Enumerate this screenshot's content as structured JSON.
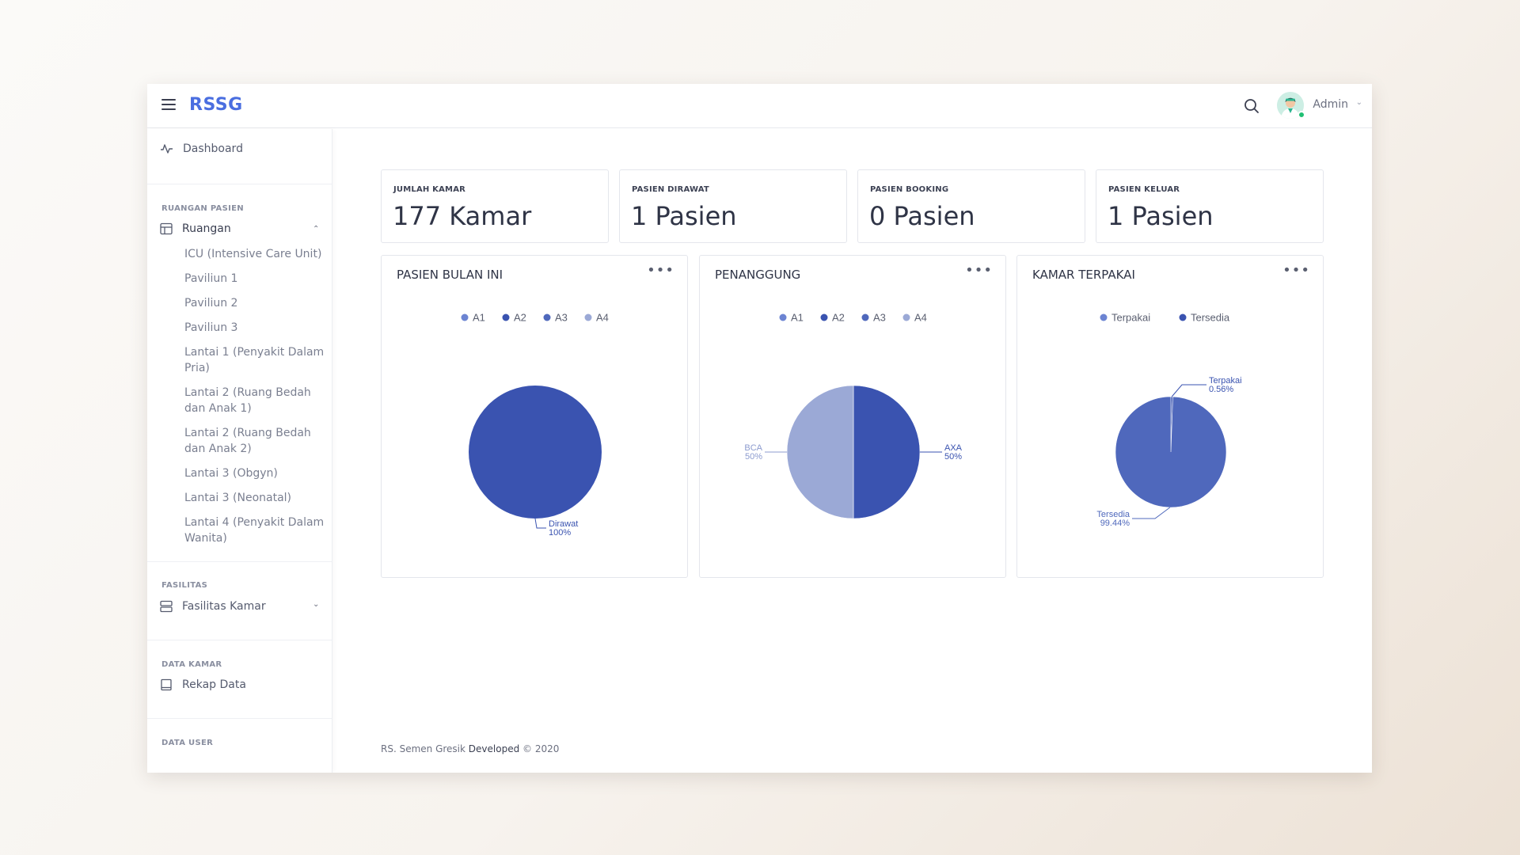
{
  "header": {
    "brand": "RSSG",
    "user_name": "Admin"
  },
  "sidebar": {
    "dashboard": "Dashboard",
    "sections": [
      {
        "heading": "RUANGAN PASIEN",
        "item": "Ruangan"
      },
      {
        "heading": "FASILITAS",
        "item": "Fasilitas Kamar"
      },
      {
        "heading": "DATA KAMAR",
        "item": "Rekap Data"
      },
      {
        "heading": "DATA USER"
      }
    ],
    "ruangan_items": [
      "ICU (Intensive Care Unit)",
      "Paviliun 1",
      "Paviliun 2",
      "Paviliun 3",
      "Lantai 1 (Penyakit Dalam Pria)",
      "Lantai 2 (Ruang Bedah dan Anak 1)",
      "Lantai 2 (Ruang Bedah dan Anak 2)",
      "Lantai 3 (Obgyn)",
      "Lantai 3 (Neonatal)",
      "Lantai 4 (Penyakit Dalam Wanita)"
    ]
  },
  "stats": [
    {
      "label": "JUMLAH KAMAR",
      "value": "177 Kamar"
    },
    {
      "label": "PASIEN DIRAWAT",
      "value": "1 Pasien"
    },
    {
      "label": "PASIEN BOOKING",
      "value": "0 Pasien"
    },
    {
      "label": "PASIEN KELUAR",
      "value": "1 Pasien"
    }
  ],
  "colors": {
    "brand": "#4a6ee0",
    "pie_dark": "#3a53b0",
    "pie_mid": "#4f68bc",
    "pie_light": "#9ba9d6",
    "legend": [
      "#6c84d2",
      "#3a53b0",
      "#4f68bc",
      "#9ba9d6"
    ]
  },
  "chart_data": [
    {
      "type": "pie",
      "title": "PASIEN BULAN INI",
      "legend": [
        "A1",
        "A2",
        "A3",
        "A4"
      ],
      "slices": [
        {
          "label": "Dirawat",
          "value": 100,
          "display": "100%"
        }
      ]
    },
    {
      "type": "pie",
      "title": "PENANGGUNG",
      "legend": [
        "A1",
        "A2",
        "A3",
        "A4"
      ],
      "slices": [
        {
          "label": "AXA",
          "value": 50,
          "display": "50%"
        },
        {
          "label": "BCA",
          "value": 50,
          "display": "50%"
        }
      ]
    },
    {
      "type": "pie",
      "title": "KAMAR TERPAKAI",
      "legend": [
        "Terpakai",
        "Tersedia"
      ],
      "slices": [
        {
          "label": "Terpakai",
          "value": 0.56,
          "display": "0.56%"
        },
        {
          "label": "Tersedia",
          "value": 99.44,
          "display": "99.44%"
        }
      ]
    }
  ],
  "footer": {
    "prefix": "RS. Semen Gresik",
    "developed": "Developed",
    "suffix": "© 2020"
  }
}
